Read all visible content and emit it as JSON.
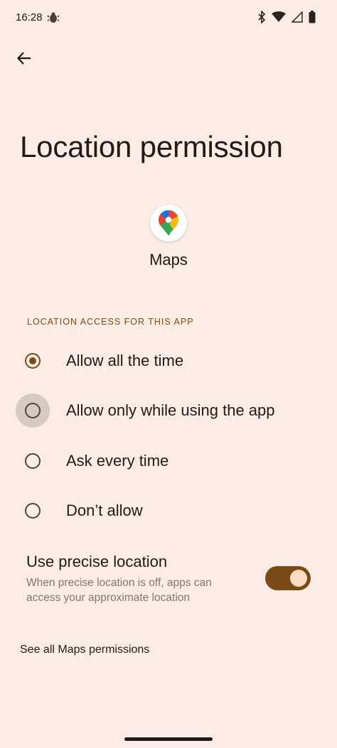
{
  "status_bar": {
    "time": "16:28",
    "left_icon": "bug-notification-icon",
    "right_icons": [
      "bluetooth-icon",
      "wifi-icon",
      "signal-icon",
      "battery-icon"
    ]
  },
  "header": {
    "back_icon": "arrow-back-icon",
    "title": "Location permission"
  },
  "app": {
    "icon": "google-maps-icon",
    "name": "Maps"
  },
  "section": {
    "header": "LOCATION ACCESS FOR THIS APP"
  },
  "options": [
    {
      "label": "Allow all the time",
      "selected": true
    },
    {
      "label": "Allow only while using the app",
      "selected": false
    },
    {
      "label": "Ask every time",
      "selected": false
    },
    {
      "label": "Don’t allow",
      "selected": false
    }
  ],
  "precise_location": {
    "title": "Use precise location",
    "description": "When precise location is off, apps can access your approximate location",
    "enabled": true
  },
  "footer": {
    "link": "See all Maps permissions"
  },
  "colors": {
    "background": "#FBEDE5",
    "accent": "#7A4A16",
    "text": "#221A15",
    "secondary_text": "#85766E",
    "toggle_thumb": "#FFDCC1"
  }
}
